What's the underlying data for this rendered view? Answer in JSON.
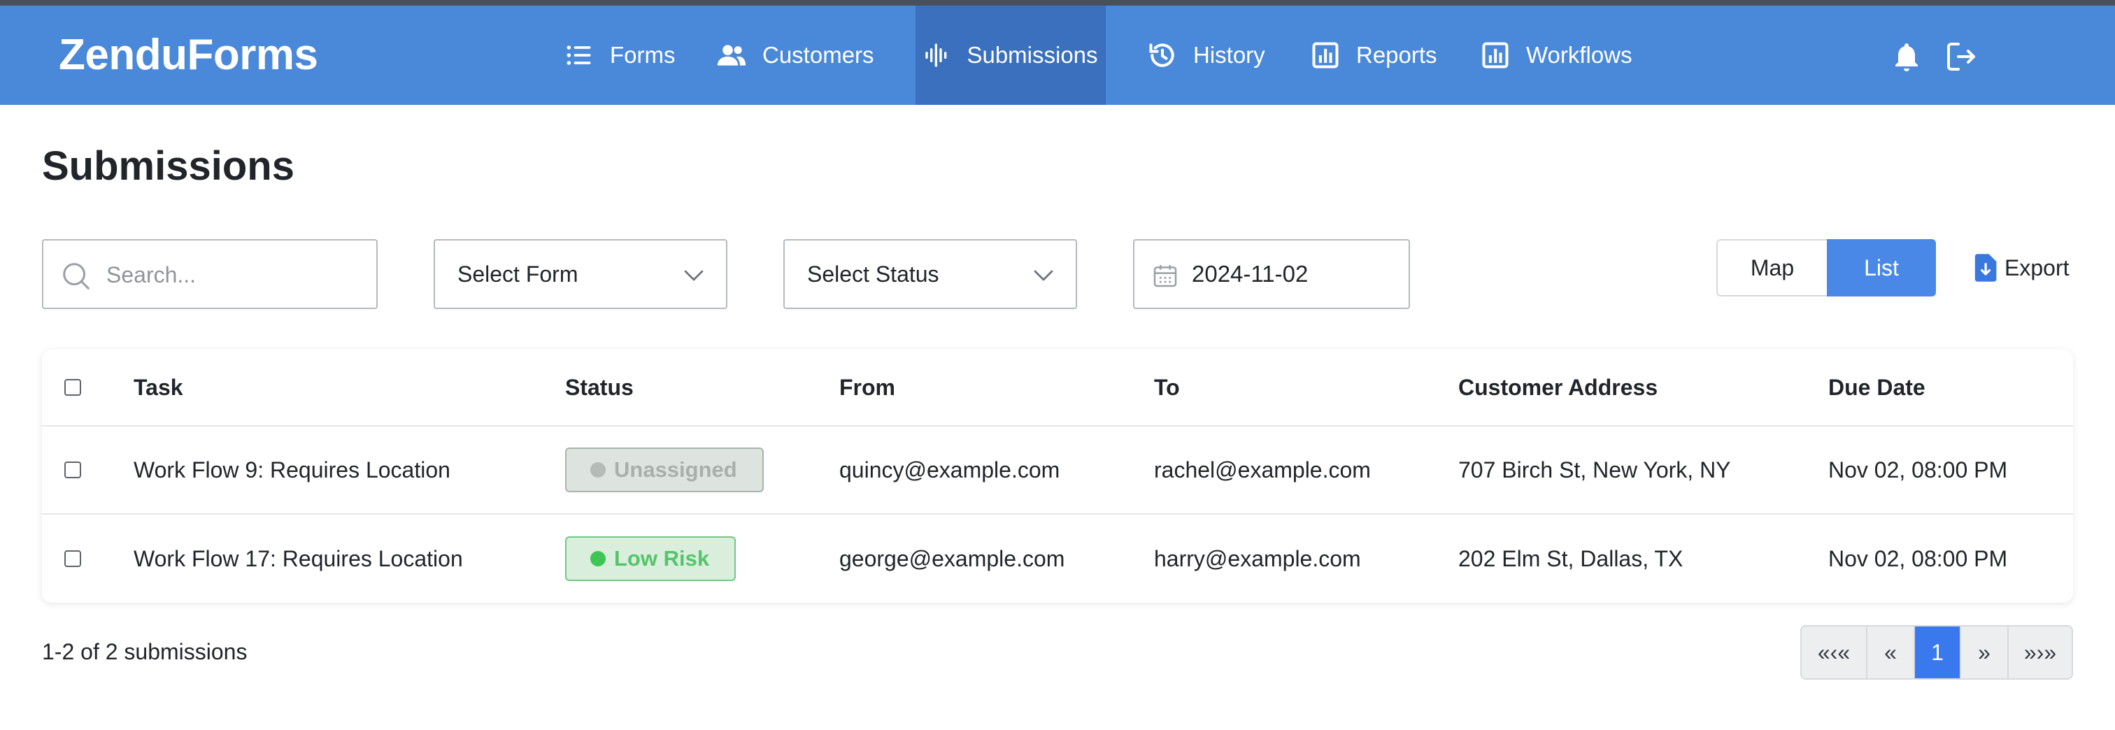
{
  "brand": "ZenduForms",
  "nav": {
    "items": [
      {
        "label": "Forms",
        "icon": "list-icon"
      },
      {
        "label": "Customers",
        "icon": "users-icon"
      },
      {
        "label": "Submissions",
        "icon": "waveform-icon",
        "active": true
      },
      {
        "label": "History",
        "icon": "history-icon"
      },
      {
        "label": "Reports",
        "icon": "bar-chart-icon"
      },
      {
        "label": "Workflows",
        "icon": "bar-chart-icon"
      }
    ],
    "right_icons": [
      "bell-icon",
      "logout-icon"
    ]
  },
  "page": {
    "title": "Submissions"
  },
  "filters": {
    "search_placeholder": "Search...",
    "search_value": "",
    "form_select": "Select Form",
    "status_select": "Select Status",
    "date": "2024-11-02"
  },
  "view_toggle": {
    "map": "Map",
    "list": "List",
    "selected": "List"
  },
  "export_label": "Export",
  "table": {
    "headers": [
      "Task",
      "Status",
      "From",
      "To",
      "Customer Address",
      "Due Date"
    ],
    "rows": [
      {
        "task": "Work Flow 9: Requires Location",
        "status": "Unassigned",
        "from": "quincy@example.com",
        "to": "rachel@example.com",
        "address": "707 Birch St, New York, NY",
        "due": "Nov 02, 08:00 PM"
      },
      {
        "task": "Work Flow 17: Requires Location",
        "status": "Low Risk",
        "from": "george@example.com",
        "to": "harry@example.com",
        "address": "202 Elm St, Dallas, TX",
        "due": "Nov 02, 08:00 PM"
      }
    ]
  },
  "summary": "1-2 of 2 submissions",
  "pagination": {
    "first": "«‹«",
    "prev": "«",
    "current": "1",
    "next": "»",
    "last": "»›»"
  },
  "colors": {
    "navbar": "#4a88d9",
    "nav_active": "#3a70bd",
    "accent": "#4a88e8",
    "badge_low_risk": "#55c46a",
    "badge_unassigned": "#a9b0ab"
  }
}
